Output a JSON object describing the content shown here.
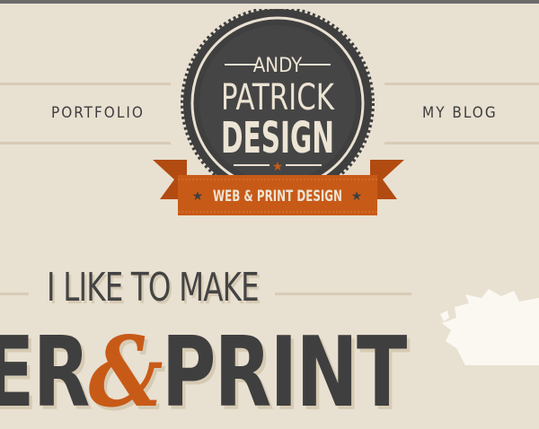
{
  "header": {
    "nav_left": "PORTFOLIO",
    "nav_right": "MY BLOG"
  },
  "badge": {
    "line1": "ANDY",
    "line2": "PATRICK",
    "line3": "DESIGN",
    "ribbon": "WEB & PRINT DESIGN"
  },
  "hero": {
    "tagline": "I LIKE TO MAKE",
    "line2_left": "ER",
    "line2_amp": "&",
    "line2_right": "PRINT"
  },
  "colors": {
    "background": "#e8e0d1",
    "badge_dark": "#3f3f3f",
    "accent_orange": "#c85a17",
    "rule": "#d8ccb6"
  }
}
